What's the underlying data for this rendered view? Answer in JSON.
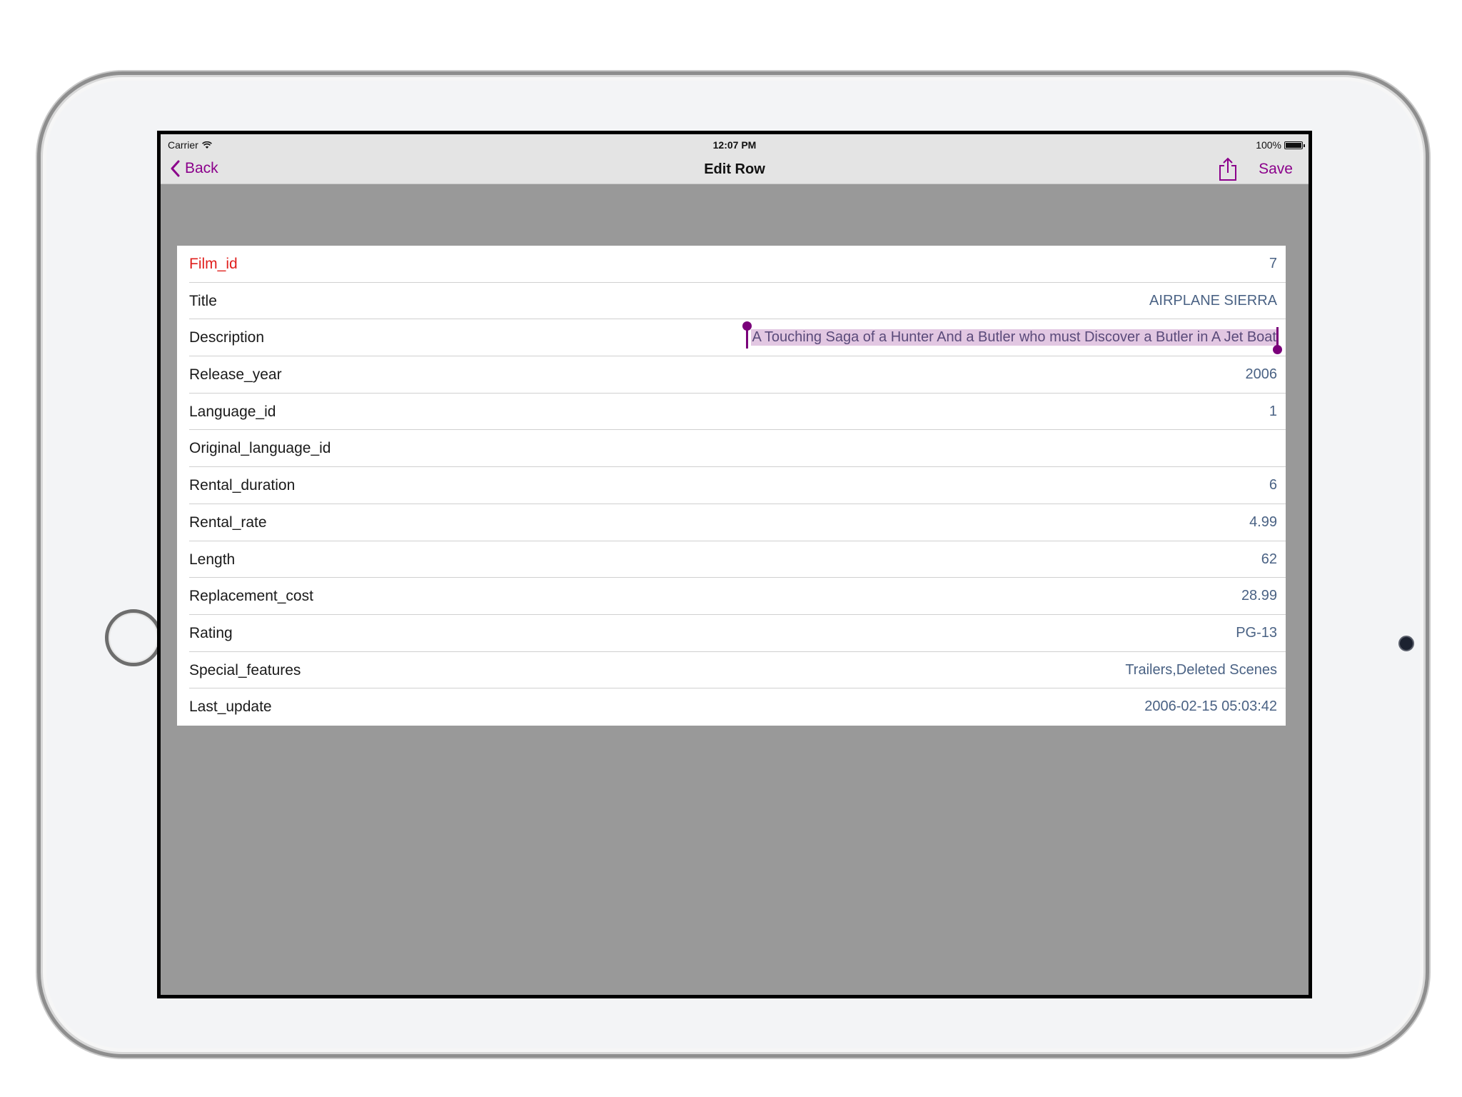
{
  "statusbar": {
    "carrier": "Carrier",
    "time": "12:07 PM",
    "battery": "100%"
  },
  "navbar": {
    "back_label": "Back",
    "title": "Edit Row",
    "save_label": "Save",
    "share_icon": "share-icon",
    "tint_color": "#8b008b"
  },
  "rows": [
    {
      "label": "Film_id",
      "value": "7"
    },
    {
      "label": "Title",
      "value": "AIRPLANE SIERRA"
    },
    {
      "label": "Description",
      "value": "A Touching Saga of a Hunter And a Butler who must Discover a Butler in A Jet Boat"
    },
    {
      "label": "Release_year",
      "value": "2006"
    },
    {
      "label": "Language_id",
      "value": "1"
    },
    {
      "label": "Original_language_id",
      "value": ""
    },
    {
      "label": "Rental_duration",
      "value": "6"
    },
    {
      "label": "Rental_rate",
      "value": "4.99"
    },
    {
      "label": "Length",
      "value": "62"
    },
    {
      "label": "Replacement_cost",
      "value": "28.99"
    },
    {
      "label": "Rating",
      "value": "PG-13"
    },
    {
      "label": "Special_features",
      "value": "Trailers,Deleted Scenes"
    },
    {
      "label": "Last_update",
      "value": "2006-02-15 05:03:42"
    }
  ],
  "colors": {
    "primary_key_label": "#e0201e",
    "value_text": "#4a6284",
    "selection": "#e2c7e2",
    "background": "#999999"
  }
}
